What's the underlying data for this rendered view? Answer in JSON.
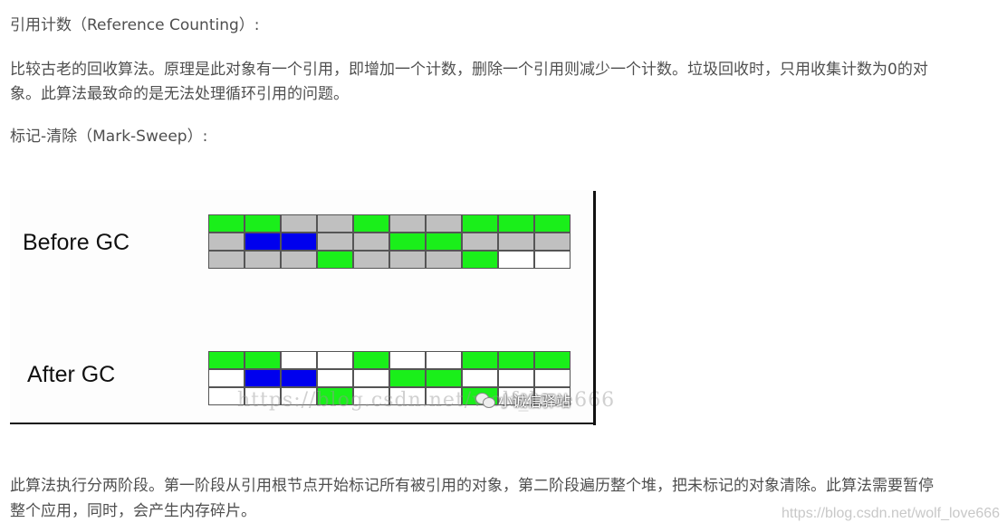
{
  "article": {
    "heading_ref_counting": "引用计数（Reference Counting）:",
    "ref_counting_line1": "比较古老的回收算法。原理是此对象有一个引用，即增加一个计数，删除一个引用则减少一个计数。垃圾回收时，只用收集计数为0的对",
    "ref_counting_line2": "象。此算法最致命的是无法处理循环引用的问题。",
    "heading_mark_sweep": "标记-清除（Mark-Sweep）:",
    "mark_sweep_line1": "此算法执行分两阶段。第一阶段从引用根节点开始标记所有被引用的对象，第二阶段遍历整个堆，把未标记的对象清除。此算法需要暂停",
    "mark_sweep_line2": "整个应用，同时，会产生内存碎片。"
  },
  "figure": {
    "before_label": "Before GC",
    "after_label": "After GC",
    "legend_colors": {
      "live": "#1aef1a",
      "root": "#0000ee",
      "garbage": "#c0c0c0",
      "free": "#ffffff"
    },
    "before_grid": [
      [
        "live",
        "live",
        "garbage",
        "garbage",
        "live",
        "garbage",
        "garbage",
        "live",
        "live",
        "live"
      ],
      [
        "garbage",
        "root",
        "root",
        "garbage",
        "garbage",
        "live",
        "live",
        "garbage",
        "garbage",
        "garbage"
      ],
      [
        "garbage",
        "garbage",
        "garbage",
        "live",
        "garbage",
        "garbage",
        "garbage",
        "live",
        "free",
        "free"
      ]
    ],
    "after_grid": [
      [
        "live",
        "live",
        "free",
        "free",
        "live",
        "free",
        "free",
        "live",
        "live",
        "live"
      ],
      [
        "free",
        "root",
        "root",
        "free",
        "free",
        "live",
        "live",
        "free",
        "free",
        "free"
      ],
      [
        "free",
        "free",
        "free",
        "live",
        "free",
        "free",
        "free",
        "live",
        "free",
        "free"
      ]
    ],
    "image_watermark_url": "https://blog.csdn.net/wolf_love666",
    "image_watermark_wechat": "小诚信驿站"
  },
  "footer_watermark": "https://blog.csdn.net/wolf_love666"
}
